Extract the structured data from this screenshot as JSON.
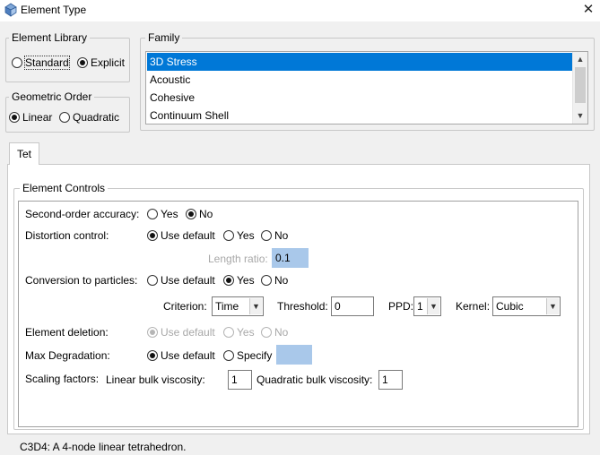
{
  "window": {
    "title": "Element Type",
    "icon": "element-type-icon",
    "close_glyph": "✕"
  },
  "element_library": {
    "legend": "Element Library",
    "options": [
      {
        "label": "Standard",
        "checked": false
      },
      {
        "label": "Explicit",
        "checked": true
      }
    ]
  },
  "geometric_order": {
    "legend": "Geometric Order",
    "options": [
      {
        "label": "Linear",
        "checked": true
      },
      {
        "label": "Quadratic",
        "checked": false
      }
    ]
  },
  "family": {
    "legend": "Family",
    "items": [
      "3D Stress",
      "Acoustic",
      "Cohesive",
      "Continuum Shell"
    ],
    "selected_index": 0,
    "scroll_up_glyph": "▲",
    "scroll_down_glyph": "▼"
  },
  "tabs": [
    {
      "label": "Tet",
      "active": true
    }
  ],
  "element_controls": {
    "legend": "Element Controls",
    "second_order_accuracy": {
      "label": "Second-order accuracy:",
      "options": [
        {
          "label": "Yes",
          "checked": false
        },
        {
          "label": "No",
          "checked": true
        }
      ]
    },
    "distortion_control": {
      "label": "Distortion control:",
      "options": [
        {
          "label": "Use default",
          "checked": true
        },
        {
          "label": "Yes",
          "checked": false
        },
        {
          "label": "No",
          "checked": false
        }
      ],
      "length_ratio_label": "Length ratio:",
      "length_ratio_value": "0.1"
    },
    "conversion_to_particles": {
      "label": "Conversion to particles:",
      "options": [
        {
          "label": "Use default",
          "checked": false
        },
        {
          "label": "Yes",
          "checked": true
        },
        {
          "label": "No",
          "checked": false
        }
      ],
      "criterion_label": "Criterion:",
      "criterion_value": "Time",
      "threshold_label": "Threshold:",
      "threshold_value": "0",
      "ppd_label": "PPD:",
      "ppd_value": "1",
      "kernel_label": "Kernel:",
      "kernel_value": "Cubic",
      "dropdown_glyph": "▼"
    },
    "element_deletion": {
      "label": "Element deletion:",
      "options": [
        {
          "label": "Use default",
          "checked": true
        },
        {
          "label": "Yes",
          "checked": false
        },
        {
          "label": "No",
          "checked": false
        }
      ]
    },
    "max_degradation": {
      "label": "Max Degradation:",
      "options": [
        {
          "label": "Use default",
          "checked": true
        },
        {
          "label": "Specify",
          "checked": false
        }
      ],
      "specify_value": ""
    },
    "scaling_factors": {
      "label": "Scaling factors:",
      "linear_label": "Linear bulk viscosity:",
      "linear_value": "1",
      "quadratic_label": "Quadratic bulk viscosity:",
      "quadratic_value": "1"
    }
  },
  "description": "C3D4:  A 4-node linear tetrahedron."
}
